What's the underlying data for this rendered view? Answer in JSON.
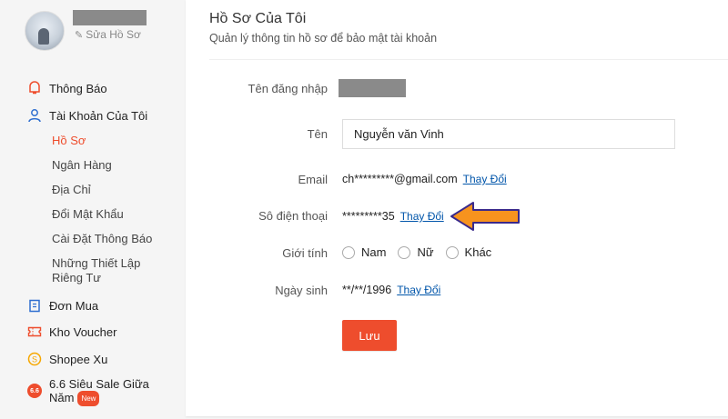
{
  "sidebar": {
    "edit_profile_label": "Sửa Hồ Sơ",
    "items": [
      {
        "label": "Thông Báo",
        "icon": "bell-icon",
        "color": "#ee4d2d"
      },
      {
        "label": "Tài Khoản Của Tôi",
        "icon": "user-icon",
        "color": "#2f6fd0"
      },
      {
        "label": "Đơn Mua",
        "icon": "clipboard-icon",
        "color": "#2f6fd0"
      },
      {
        "label": "Kho Voucher",
        "icon": "voucher-icon",
        "color": "#ee4d2d"
      },
      {
        "label": "Shopee Xu",
        "icon": "coin-icon",
        "color": "#f6a700"
      },
      {
        "label": "6.6 Siêu Sale Giữa Năm",
        "icon": "sale-66-icon",
        "color": "#ee4d2d",
        "badge": "New",
        "icon_text": "6.6"
      }
    ],
    "account_subitems": [
      {
        "label": "Hồ Sơ",
        "active": true
      },
      {
        "label": "Ngân Hàng",
        "active": false
      },
      {
        "label": "Địa Chỉ",
        "active": false
      },
      {
        "label": "Đổi Mật Khẩu",
        "active": false
      },
      {
        "label": "Cài Đặt Thông Báo",
        "active": false
      },
      {
        "label": "Những Thiết Lập Riêng Tư",
        "active": false
      }
    ]
  },
  "main": {
    "title": "Hồ Sơ Của Tôi",
    "subtitle": "Quản lý thông tin hồ sơ để bảo mật tài khoản",
    "fields": {
      "username_label": "Tên đăng nhập",
      "name_label": "Tên",
      "name_value": "Nguyễn văn Vinh",
      "email_label": "Email",
      "email_value": "ch*********@gmail.com",
      "phone_label": "Sô điện thoại",
      "phone_value": "*********35",
      "gender_label": "Giới tính",
      "gender_options": [
        "Nam",
        "Nữ",
        "Khác"
      ],
      "birthday_label": "Ngày sinh",
      "birthday_value": "**/**/1996",
      "change_link": "Thay Đổi"
    },
    "save_label": "Lưu"
  },
  "colors": {
    "accent": "#ee4d2d",
    "link": "#0055aa",
    "arrow_fill": "#f7931e",
    "arrow_stroke": "#3a2a8c"
  }
}
